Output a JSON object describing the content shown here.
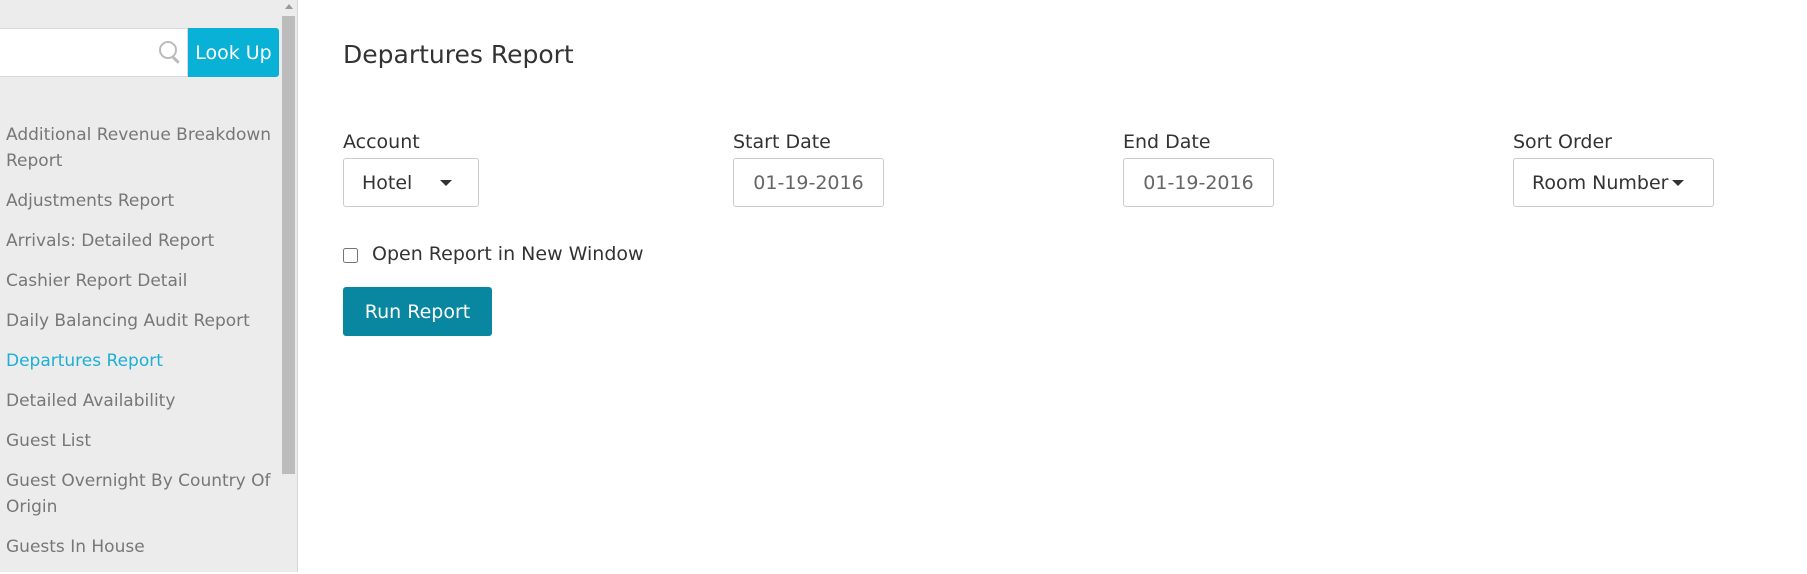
{
  "sidebar": {
    "search": {
      "placeholder": "",
      "value": "",
      "icon": "search-icon"
    },
    "lookup_label": "Look Up",
    "active_item": "Departures Report",
    "items": [
      {
        "label": "Additional Revenue Breakdown Report"
      },
      {
        "label": "Adjustments Report"
      },
      {
        "label": "Arrivals: Detailed Report"
      },
      {
        "label": "Cashier Report Detail"
      },
      {
        "label": "Daily Balancing Audit Report"
      },
      {
        "label": "Departures Report"
      },
      {
        "label": "Detailed Availability"
      },
      {
        "label": "Guest List"
      },
      {
        "label": "Guest Overnight By Country Of Origin"
      },
      {
        "label": "Guests In House"
      }
    ]
  },
  "main": {
    "title": "Departures Report",
    "account": {
      "label": "Account",
      "value": "Hotel"
    },
    "start_date": {
      "label": "Start Date",
      "value": "01-19-2016"
    },
    "end_date": {
      "label": "End Date",
      "value": "01-19-2016"
    },
    "sort_order": {
      "label": "Sort Order",
      "value": "Room Number"
    },
    "open_new_window": {
      "label": "Open Report in New Window",
      "checked": false
    },
    "run_label": "Run Report"
  },
  "colors": {
    "accent": "#0ab1d6",
    "active_link": "#1ab0d6",
    "run_button": "#0a87a0",
    "sidebar_bg": "#ececec"
  }
}
